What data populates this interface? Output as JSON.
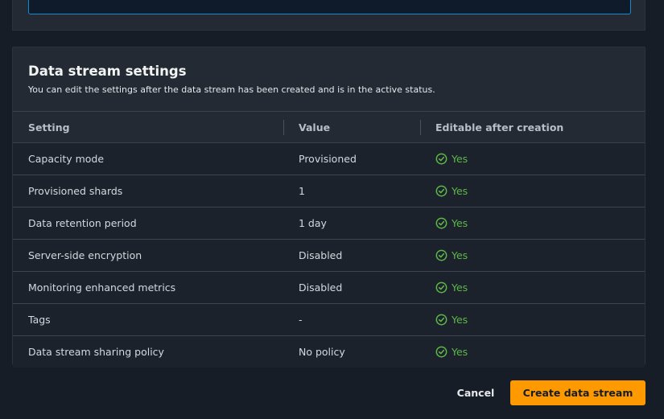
{
  "settings_panel": {
    "title": "Data stream settings",
    "description": "You can edit the settings after the data stream has been created and is in the active status.",
    "columns": [
      "Setting",
      "Value",
      "Editable after creation"
    ],
    "rows": [
      {
        "setting": "Capacity mode",
        "value": "Provisioned",
        "editable": "Yes"
      },
      {
        "setting": "Provisioned shards",
        "value": "1",
        "editable": "Yes"
      },
      {
        "setting": "Data retention period",
        "value": "1 day",
        "editable": "Yes"
      },
      {
        "setting": "Server-side encryption",
        "value": "Disabled",
        "editable": "Yes"
      },
      {
        "setting": "Monitoring enhanced metrics",
        "value": "Disabled",
        "editable": "Yes"
      },
      {
        "setting": "Tags",
        "value": "-",
        "editable": "Yes"
      },
      {
        "setting": "Data stream sharing policy",
        "value": "No policy",
        "editable": "Yes"
      }
    ]
  },
  "footer": {
    "cancel_label": "Cancel",
    "create_label": "Create data stream"
  },
  "colors": {
    "background": "#161d26",
    "panel": "#232a34",
    "primary_button": "#ff9900",
    "success": "#5fb64a",
    "focus_border": "#0d8ecc"
  },
  "icons": {
    "editable_status": "check-circle-icon"
  }
}
